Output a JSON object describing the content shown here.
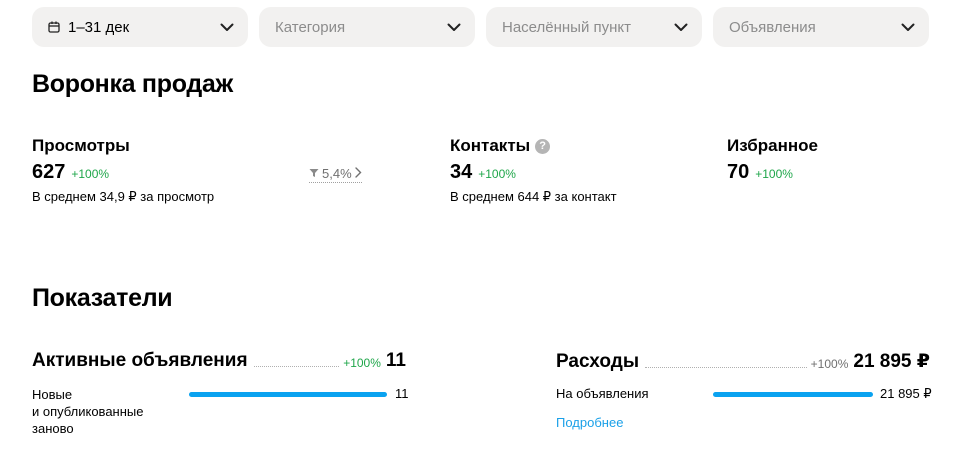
{
  "filters": {
    "period": {
      "label": "1–31 дек",
      "icon": "calendar-icon"
    },
    "category": {
      "placeholder": "Категория"
    },
    "city": {
      "placeholder": "Населённый пункт"
    },
    "ads": {
      "placeholder": "Объявления"
    }
  },
  "funnel": {
    "title": "Воронка продаж",
    "views": {
      "label": "Просмотры",
      "value": "627",
      "delta": "+100%",
      "sub": "В среднем 34,9 ₽ за просмотр"
    },
    "conversion": {
      "value": "5,4%",
      "icon": "funnel-icon"
    },
    "contacts": {
      "label": "Контакты",
      "value": "34",
      "delta": "+100%",
      "sub": "В среднем 644 ₽ за контакт",
      "help": "?"
    },
    "favorites": {
      "label": "Избранное",
      "value": "70",
      "delta": "+100%"
    }
  },
  "indicators": {
    "title": "Показатели",
    "active_ads": {
      "title": "Активные объявления",
      "delta": "+100%",
      "value": "11",
      "rows": [
        {
          "label_lines": [
            "Новые",
            "и опубликованные",
            "заново"
          ],
          "value": "11",
          "fraction": 1.0
        }
      ]
    },
    "expenses": {
      "title": "Расходы",
      "delta": "+100%",
      "value": "21 895 ₽",
      "rows": [
        {
          "label": "На объявления",
          "value": "21 895 ₽",
          "fraction": 1.0
        }
      ],
      "details_link": "Подробнее"
    }
  },
  "colors": {
    "accent_blue": "#0aa2f0",
    "positive_green": "#1fa64a",
    "filter_bg": "#f2f1f0"
  }
}
